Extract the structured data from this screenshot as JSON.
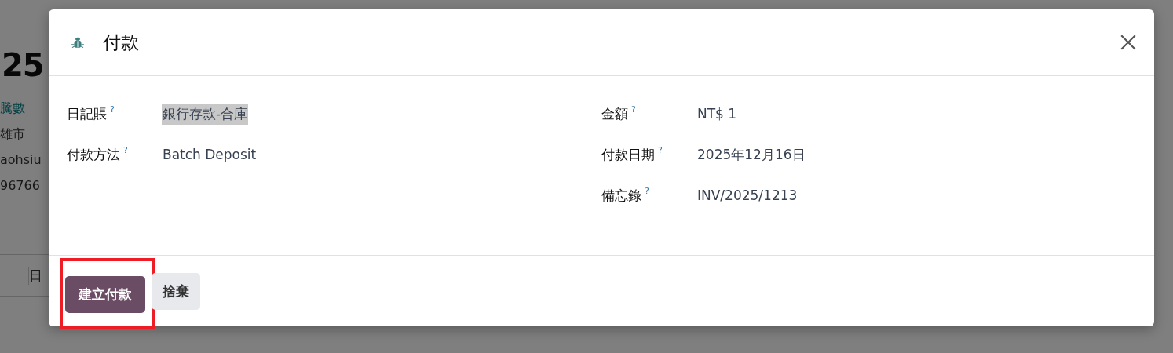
{
  "background": {
    "heading": "25",
    "lines": [
      {
        "text": "騰數",
        "kind": "link"
      },
      {
        "text": "雄市",
        "kind": "text"
      },
      {
        "text": "aohsiu",
        "kind": "text"
      },
      {
        "text": "96766",
        "kind": "text"
      }
    ],
    "tab": "日"
  },
  "dialog": {
    "title": "付款",
    "left_fields": [
      {
        "label": "日記賬",
        "help": "?",
        "value": "銀行存款-合庫",
        "highlighted": true
      },
      {
        "label": "付款方法",
        "help": "?",
        "value": "Batch Deposit",
        "highlighted": false
      }
    ],
    "right_fields": [
      {
        "label": "金額",
        "help": "?",
        "value": "NT$ 1",
        "highlighted": false
      },
      {
        "label": "付款日期",
        "help": "?",
        "value": "2025年12月16日",
        "highlighted": false
      },
      {
        "label": "備忘錄",
        "help": "?",
        "value": "INV/2025/1213",
        "highlighted": false
      }
    ],
    "buttons": [
      {
        "label": "建立付款",
        "kind": "primary",
        "highlighted": true
      },
      {
        "label": "捨棄",
        "kind": "secondary",
        "highlighted": false
      }
    ]
  }
}
